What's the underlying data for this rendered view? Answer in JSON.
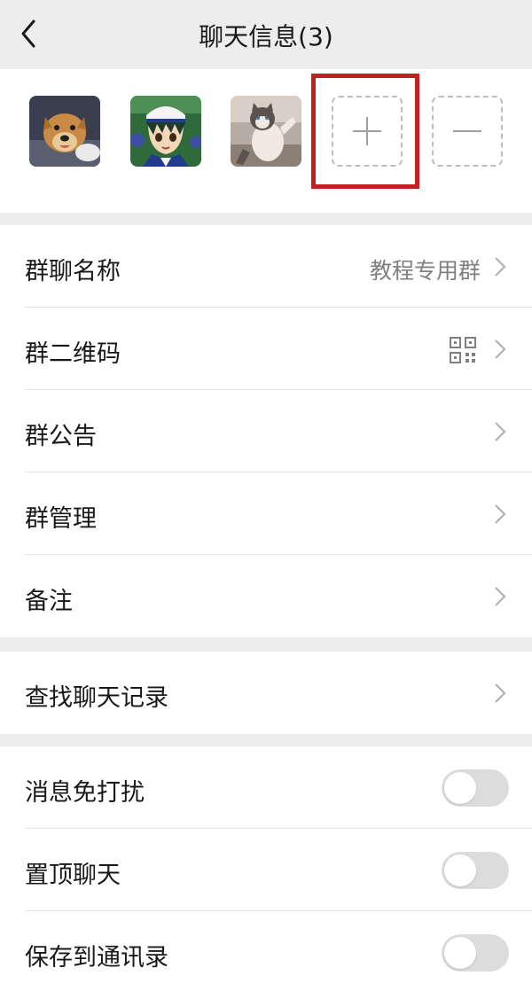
{
  "header": {
    "title": "聊天信息(3)"
  },
  "members": {
    "avatars": [
      {
        "name": "dog-avatar",
        "colors": [
          "#3a3f50",
          "#c98a45",
          "#e8c99a"
        ]
      },
      {
        "name": "anime-avatar",
        "colors": [
          "#2e6a3a",
          "#f2d6b8",
          "#1f3d8a"
        ]
      },
      {
        "name": "cat-avatar",
        "colors": [
          "#9c8f86",
          "#d9cfc6",
          "#5b524d"
        ]
      }
    ]
  },
  "settings": {
    "group_name_label": "群聊名称",
    "group_name_value": "教程专用群",
    "qr_label": "群二维码",
    "notice_label": "群公告",
    "manage_label": "群管理",
    "remark_label": "备注",
    "search_history_label": "查找聊天记录",
    "mute_label": "消息免打扰",
    "pin_label": "置顶聊天",
    "save_contacts_label": "保存到通讯录"
  },
  "colors": {
    "highlight": "#c0211f",
    "toggle_off": "#dcdcdc"
  }
}
